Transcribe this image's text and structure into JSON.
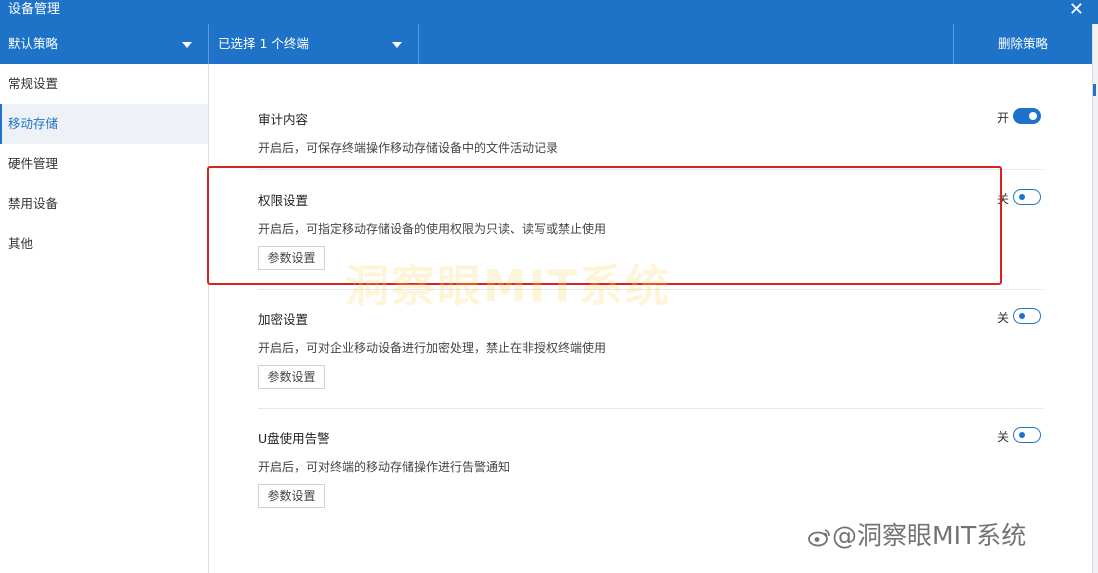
{
  "window": {
    "title": "设备管理",
    "close_glyph": "✕"
  },
  "toolbar": {
    "policy_select": "默认策略",
    "terminal_select": "已选择 1 个终端",
    "delete_button": "删除策略",
    "caret_icon": "caret-down-icon"
  },
  "sidebar": {
    "items": [
      {
        "label": "常规设置",
        "active": false
      },
      {
        "label": "移动存储",
        "active": true
      },
      {
        "label": "硬件管理",
        "active": false
      },
      {
        "label": "禁用设备",
        "active": false
      },
      {
        "label": "其他",
        "active": false
      }
    ]
  },
  "sections": [
    {
      "title": "审计内容",
      "desc": "开启后，可保存终端操作移动存储设备中的文件活动记录",
      "toggle_label": "开",
      "enabled": true
    },
    {
      "title": "权限设置",
      "desc": "开启后，可指定移动存储设备的使用权限为只读、读写或禁止使用",
      "button": "参数设置",
      "toggle_label": "关",
      "enabled": false
    },
    {
      "title": "加密设置",
      "desc": "开启后，可对企业移动设备进行加密处理，禁止在非授权终端使用",
      "button": "参数设置",
      "toggle_label": "关",
      "enabled": false
    },
    {
      "title": "U盘使用告警",
      "desc": "开启后，可对终端的移动存储操作进行告警通知",
      "button": "参数设置",
      "toggle_label": "关",
      "enabled": false
    }
  ],
  "watermarks": {
    "center": "洞察眼MIT系统",
    "corner": "@洞察眼MIT系统"
  },
  "colors": {
    "accent": "#1e73c8",
    "highlight": "#d9231e"
  }
}
